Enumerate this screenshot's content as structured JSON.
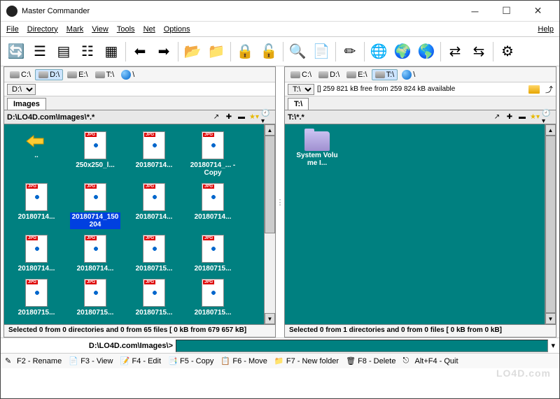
{
  "window": {
    "title": "Master Commander"
  },
  "menu": {
    "items": [
      "File",
      "Directory",
      "Mark",
      "View",
      "Tools",
      "Net",
      "Options"
    ],
    "help": "Help"
  },
  "toolbar_icons": [
    "refresh-icon",
    "view-list-icon",
    "view-detail-icon",
    "view-tree-icon",
    "view-thumbs-icon",
    "sep",
    "arrow-left-icon",
    "arrow-right-icon",
    "sep",
    "folder-open-icon",
    "folder-up-icon",
    "sep",
    "lock-icon",
    "lock-open-icon",
    "sep",
    "search-icon",
    "note-icon",
    "sep",
    "edit-icon",
    "sep",
    "globe-down-icon",
    "globe-up-icon",
    "globe-folder-icon",
    "sep",
    "compare-icon",
    "sync-icon",
    "sep",
    "gear-icon"
  ],
  "panes": {
    "left": {
      "drives": [
        "C:\\",
        "D:\\",
        "E:\\",
        "T:\\"
      ],
      "active_drive_index": 1,
      "drive_select": "D:\\",
      "free_text": "",
      "tab": "Images",
      "header_path": "D:\\LO4D.com\\Images\\*.*",
      "files": [
        {
          "type": "up",
          "label": ".."
        },
        {
          "type": "jpg",
          "label": "250x250_l..."
        },
        {
          "type": "jpg",
          "label": "20180714..."
        },
        {
          "type": "jpg",
          "label": "20180714_... - Copy"
        },
        {
          "type": "jpg",
          "label": "20180714..."
        },
        {
          "type": "jpg",
          "label": "20180714_150204",
          "selected": true
        },
        {
          "type": "jpg",
          "label": "20180714..."
        },
        {
          "type": "jpg",
          "label": "20180714..."
        },
        {
          "type": "jpg",
          "label": "20180714..."
        },
        {
          "type": "jpg",
          "label": "20180714..."
        },
        {
          "type": "jpg",
          "label": "20180715..."
        },
        {
          "type": "jpg",
          "label": "20180715..."
        },
        {
          "type": "jpg",
          "label": "20180715..."
        },
        {
          "type": "jpg",
          "label": "20180715..."
        },
        {
          "type": "jpg",
          "label": "20180715..."
        },
        {
          "type": "jpg",
          "label": "20180715..."
        }
      ],
      "status": "Selected 0 from 0 directories and 0 from 65 files [ 0 kB from 679 657 kB]"
    },
    "right": {
      "drives": [
        "C:\\",
        "D:\\",
        "E:\\",
        "T:\\"
      ],
      "active_drive_index": 3,
      "drive_select": "T:\\",
      "free_text": "[] 259 821 kB free from 259 824 kB available",
      "tab": "T:\\",
      "header_path": "T:\\*.*",
      "files": [
        {
          "type": "folder",
          "label": "System Volume I..."
        }
      ],
      "status": "Selected 0 from 1 directories and 0 from 0 files [ 0 kB from 0 kB]"
    }
  },
  "cmd": {
    "label": "D:\\LO4D.com\\Images\\>"
  },
  "fkeys": [
    {
      "key": "F2",
      "label": "Rename",
      "icon": "rename-icon"
    },
    {
      "key": "F3",
      "label": "View",
      "icon": "view-icon"
    },
    {
      "key": "F4",
      "label": "Edit",
      "icon": "edit-icon"
    },
    {
      "key": "F5",
      "label": "Copy",
      "icon": "copy-icon"
    },
    {
      "key": "F6",
      "label": "Move",
      "icon": "move-icon"
    },
    {
      "key": "F7",
      "label": "New folder",
      "icon": "newfolder-icon"
    },
    {
      "key": "F8",
      "label": "Delete",
      "icon": "delete-icon"
    },
    {
      "key": "Alt+F4",
      "label": "Quit",
      "icon": "quit-icon"
    }
  ],
  "watermark": "LO4D.com"
}
